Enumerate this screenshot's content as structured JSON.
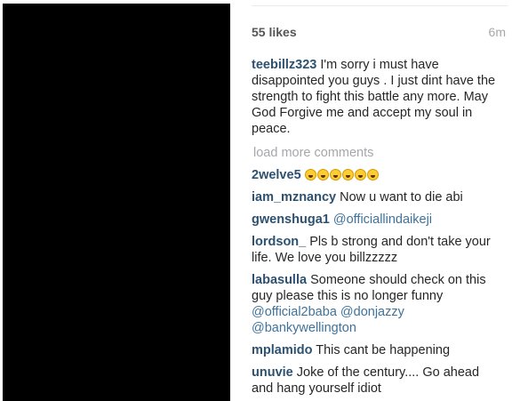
{
  "post": {
    "likes": "55 likes",
    "time": "6m"
  },
  "caption": {
    "username": "teebillz323",
    "text": "I'm sorry i must have disappointed you guys . I just dint have the strength to fight this battle any more. May God Forgive me and accept my soul in peace."
  },
  "load_more": "load more comments",
  "comments": [
    {
      "username": "2welve5",
      "text": "",
      "emoji_icon": "laughing-tears-emoji",
      "emoji_count": 6
    },
    {
      "username": "iam_mznancy",
      "text": "Now u want to die abi"
    },
    {
      "username": "gwenshuga1",
      "mention": "@officiallindaikeji"
    },
    {
      "username": "lordson_",
      "text": "Pls b strong and don't take your life. We love you billzzzzz"
    },
    {
      "username": "labasulla",
      "text": "Someone should check on this guy please this is no longer funny",
      "mentions": [
        "@official2baba",
        "@donjazzy",
        "@bankywellington"
      ]
    },
    {
      "username": "mplamido",
      "text": "This cant be happening"
    },
    {
      "username": "unuvie",
      "text": "Joke of the century.... Go ahead and hang yourself idiot"
    }
  ]
}
